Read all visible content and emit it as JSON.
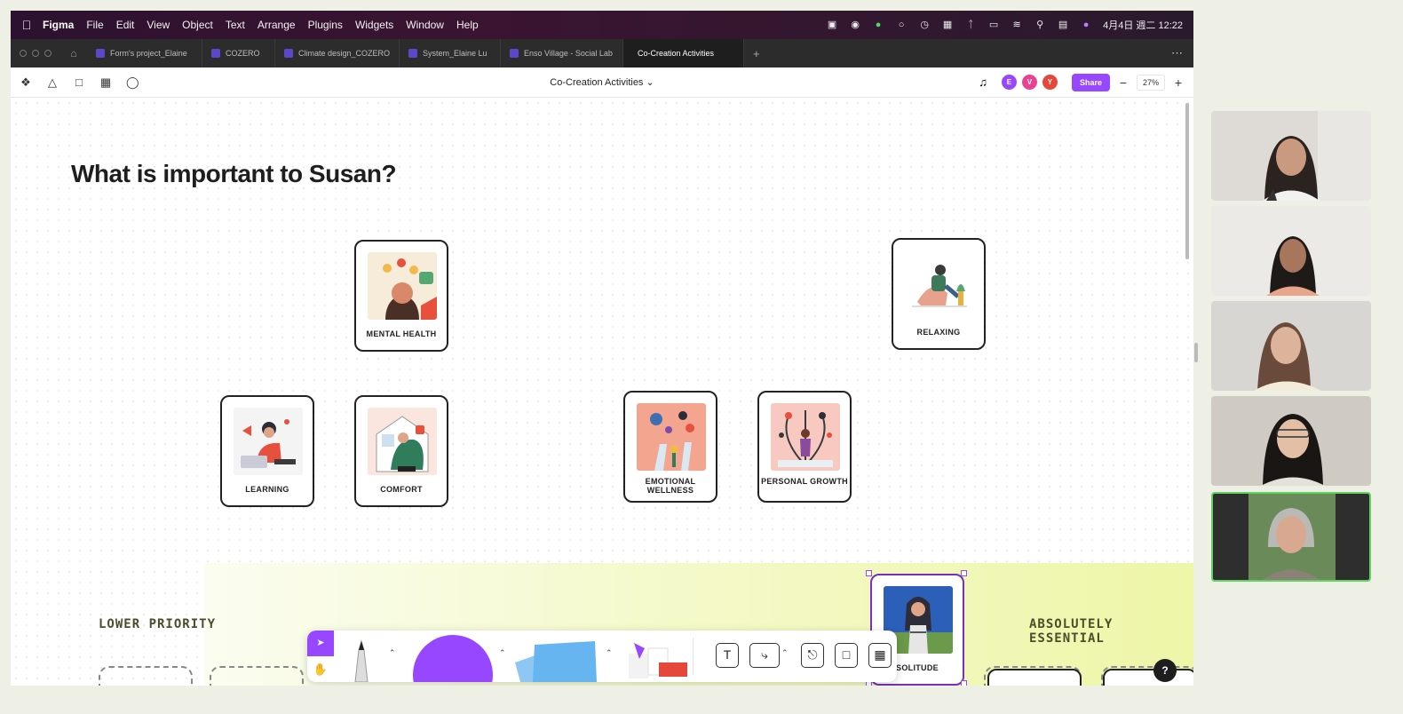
{
  "menubar": {
    "app": "Figma",
    "items": [
      "File",
      "Edit",
      "View",
      "Object",
      "Text",
      "Arrange",
      "Plugins",
      "Widgets",
      "Window",
      "Help"
    ],
    "datetime": "4月4日 週二  12:22"
  },
  "tabs": [
    {
      "label": "Form's project_Elaine",
      "width": 130
    },
    {
      "label": "COZERO",
      "width": 82
    },
    {
      "label": "Climate design_COZERO",
      "width": 140
    },
    {
      "label": "System_Elaine Lu",
      "width": 114
    },
    {
      "label": "Enso Village - Social Lab",
      "width": 138
    },
    {
      "label": "Co-Creation Activities",
      "width": 136,
      "active": true
    }
  ],
  "toolbar": {
    "file_title": "Co-Creation Activities",
    "share_label": "Share",
    "zoom": "27%",
    "avatars": [
      {
        "letter": "E",
        "color": "#9747ff"
      },
      {
        "letter": "V",
        "color": "#e84393"
      },
      {
        "letter": "Y",
        "color": "#e5483a"
      }
    ]
  },
  "canvas": {
    "heading": "What is important to Susan?",
    "cards": {
      "mental_health": "MENTAL HEALTH",
      "relaxing": "RELAXING",
      "learning": "LEARNING",
      "comfort": "COMFORT",
      "emotional_wellness": "EMOTIONAL WELLNESS",
      "personal_growth": "PERSONAL GROWTH",
      "solitude": "SOLITUDE"
    },
    "lower_priority": "LOWER PRIORITY",
    "absolutely_essential": "ABSOLUTELY ESSENTIAL",
    "help": "?"
  },
  "colors": {
    "accent": "#9747ff",
    "active_speaker": "#5fd35f"
  }
}
